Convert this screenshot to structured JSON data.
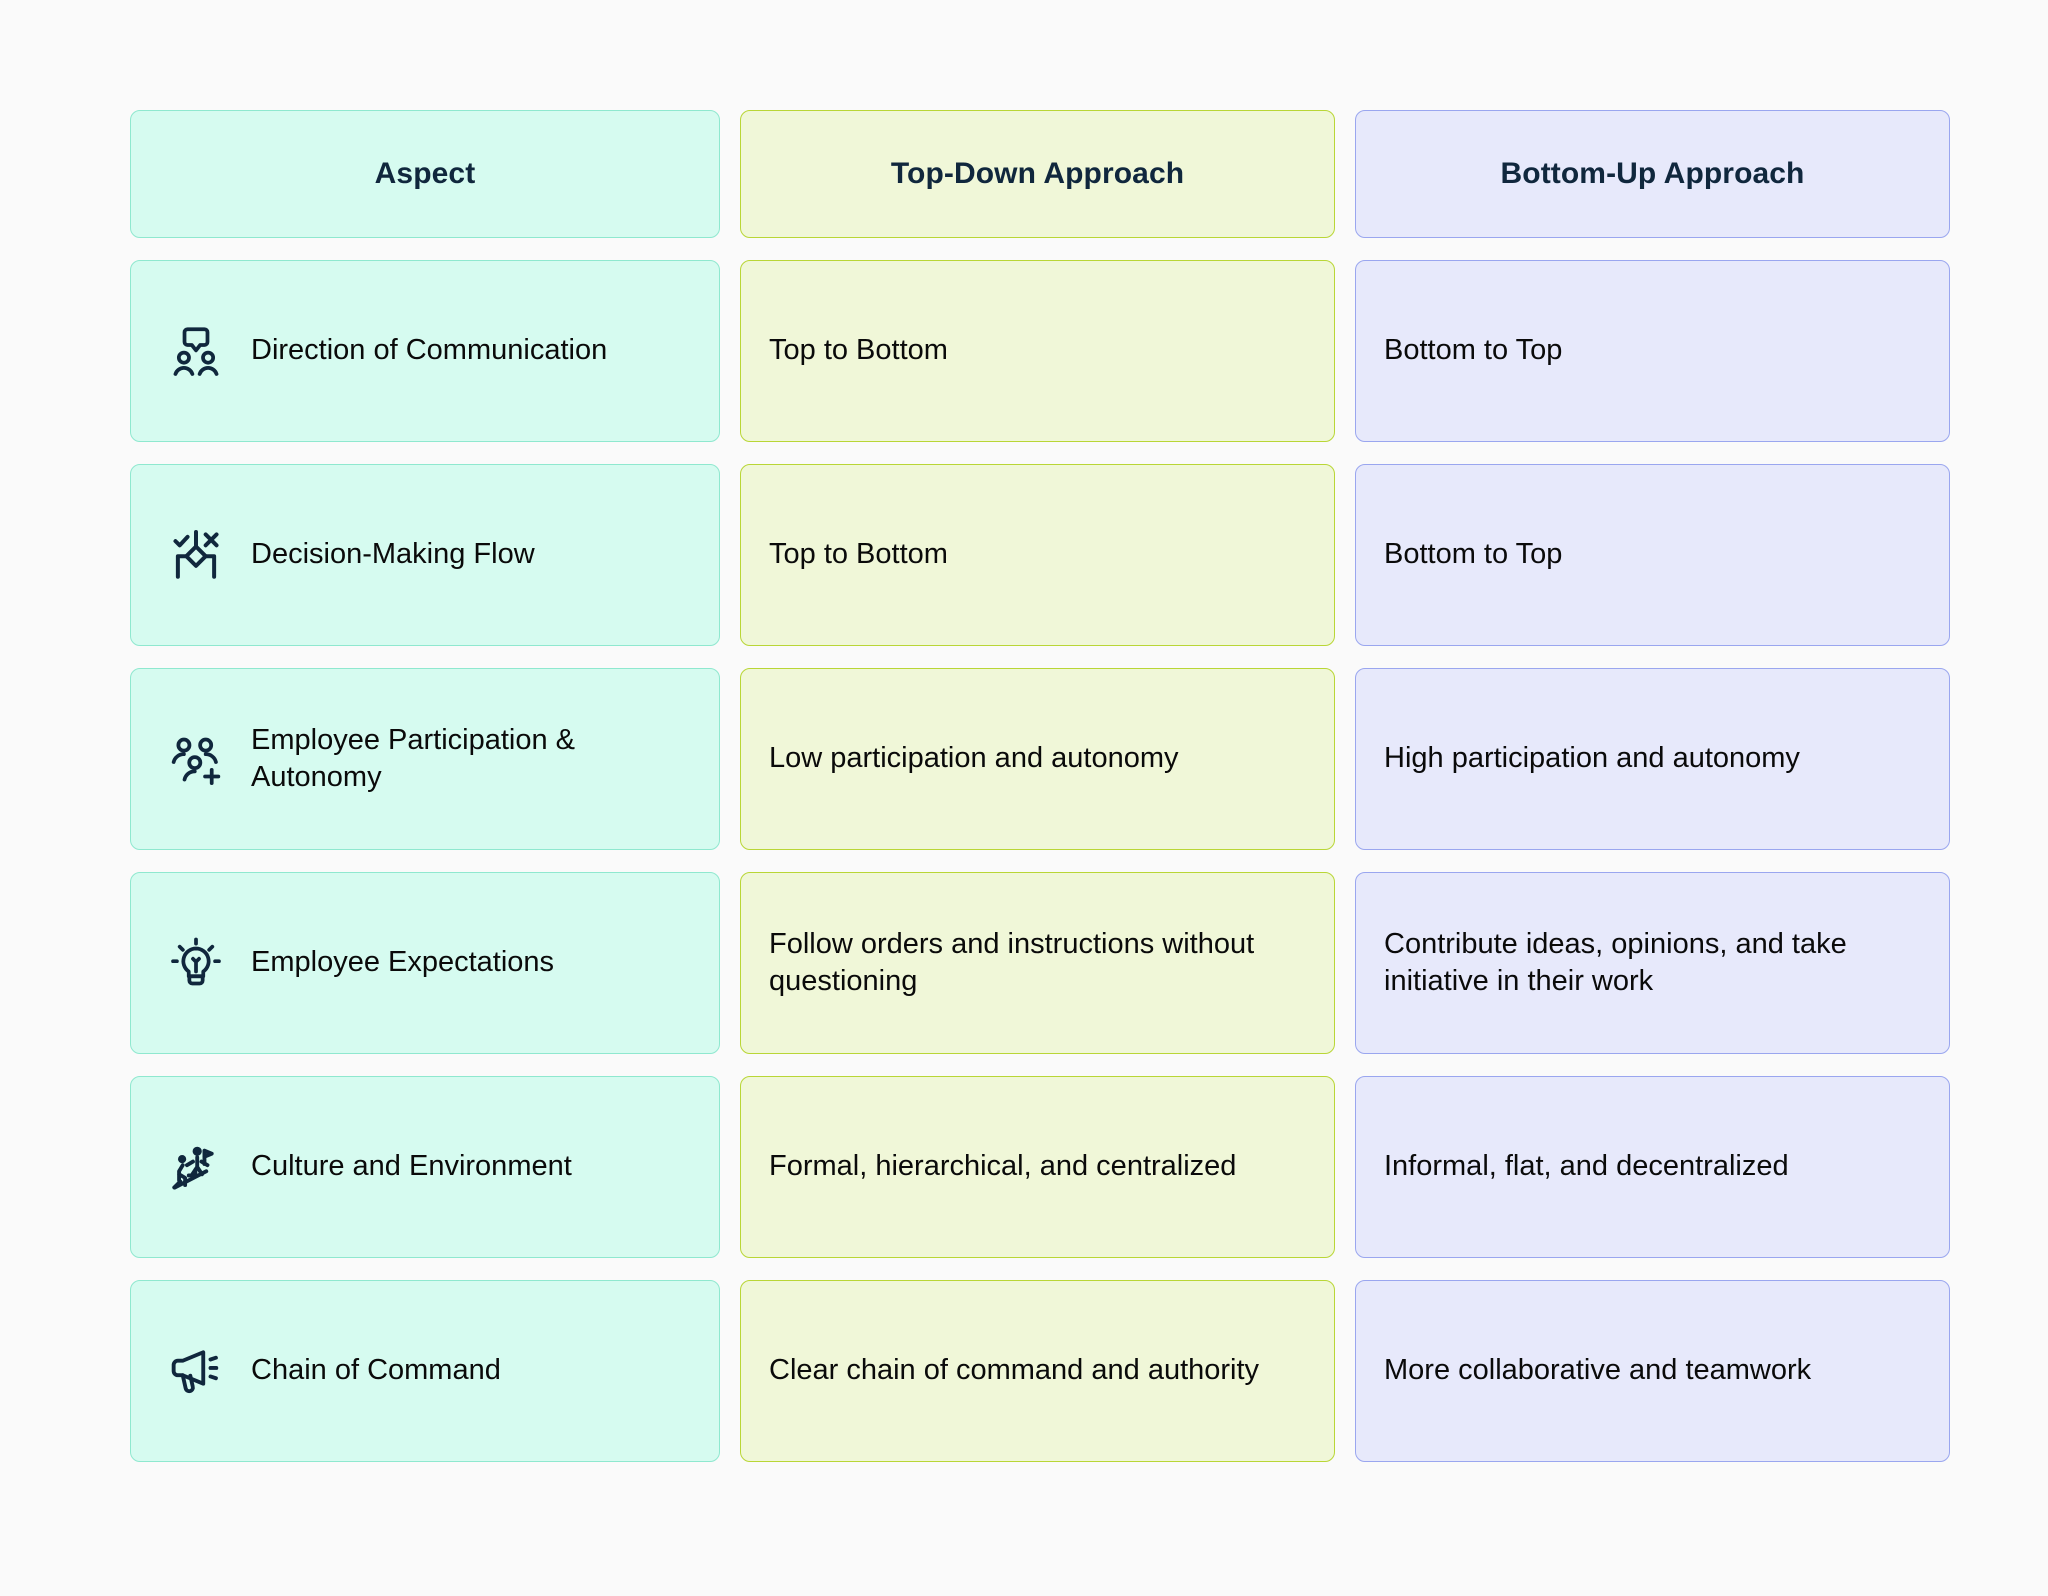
{
  "page": {
    "background_color": "#fafafa",
    "heading_text_color": "#10273d",
    "body_text_color": "#0a0a0a"
  },
  "columns": {
    "aspect": {
      "header": "Aspect",
      "background_color": "#d6fbf0",
      "border_color": "#8fe8cf"
    },
    "top_down": {
      "header": "Top-Down Approach",
      "background_color": "#f0f7d8",
      "border_color": "#b9d636"
    },
    "bottom_up": {
      "header": "Bottom-Up Approach",
      "background_color": "#e7e9fb",
      "border_color": "#9aa6ef"
    }
  },
  "rows": [
    {
      "icon": "speech-bubble-people-icon",
      "aspect": "Direction of Communication",
      "top_down": "Top to Bottom",
      "bottom_up": "Bottom to Top"
    },
    {
      "icon": "decision-flow-diamond-icon",
      "aspect": "Decision-Making Flow",
      "top_down": "Top to Bottom",
      "bottom_up": "Bottom to Top"
    },
    {
      "icon": "users-plus-icon",
      "aspect": "Employee Participation & Autonomy",
      "top_down": "Low participation and autonomy",
      "bottom_up": "High participation and autonomy"
    },
    {
      "icon": "lightbulb-icon",
      "aspect": "Employee Expectations",
      "top_down": "Follow orders and instructions without questioning",
      "bottom_up": "Contribute ideas, opinions, and take initiative in their work"
    },
    {
      "icon": "people-climbing-stairs-flag-icon",
      "aspect": "Culture and Environment",
      "top_down": "Formal, hierarchical, and centralized",
      "bottom_up": "Informal, flat, and decentralized"
    },
    {
      "icon": "megaphone-icon",
      "aspect": "Chain of Command",
      "top_down": "Clear chain of command and authority",
      "bottom_up": "More collaborative and teamwork"
    }
  ]
}
